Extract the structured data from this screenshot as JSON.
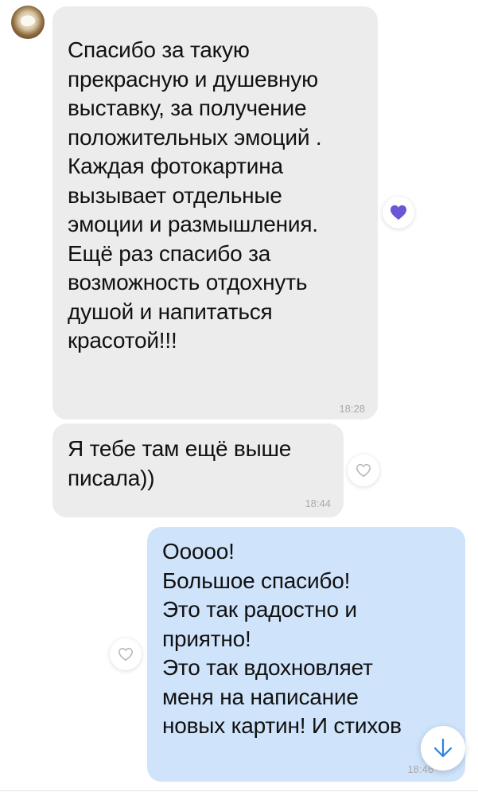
{
  "chat": {
    "messages": [
      {
        "direction": "incoming",
        "text": "Спасибо за такую\nпрекрасную и душевную\nвыставку, за получение\nположительных эмоций .\nКаждая фотокартина\nвызывает отдельные\nэмоции и размышления.\nЕщё раз спасибо за\nвозможность отдохнуть\nдушой и напитаться\nкрасотой!!!",
        "time": "18:28",
        "reaction": "heart-filled"
      },
      {
        "direction": "incoming",
        "text": "Я тебе там ещё выше\nписала))",
        "time": "18:44",
        "reaction": "heart-outline"
      },
      {
        "direction": "outgoing",
        "text": "Ооооо!\nБольшое спасибо!\nЭто так радостно и\nприятно!\nЭто так вдохновляет\nменя на написание\nновых картин! И стихов",
        "time": "18:46",
        "reaction": "heart-outline"
      }
    ]
  },
  "colors": {
    "incoming_bubble": "#ececec",
    "outgoing_bubble": "#cfe3fb",
    "heart_filled": "#6b56d6",
    "icon_gray": "#b5b5b5",
    "scroll_arrow": "#2f7fe0"
  },
  "icons": {
    "avatar": "contact-avatar",
    "reaction_filled": "heart-filled-icon",
    "reaction_outline": "heart-outline-icon",
    "scroll": "arrow-down-icon"
  }
}
